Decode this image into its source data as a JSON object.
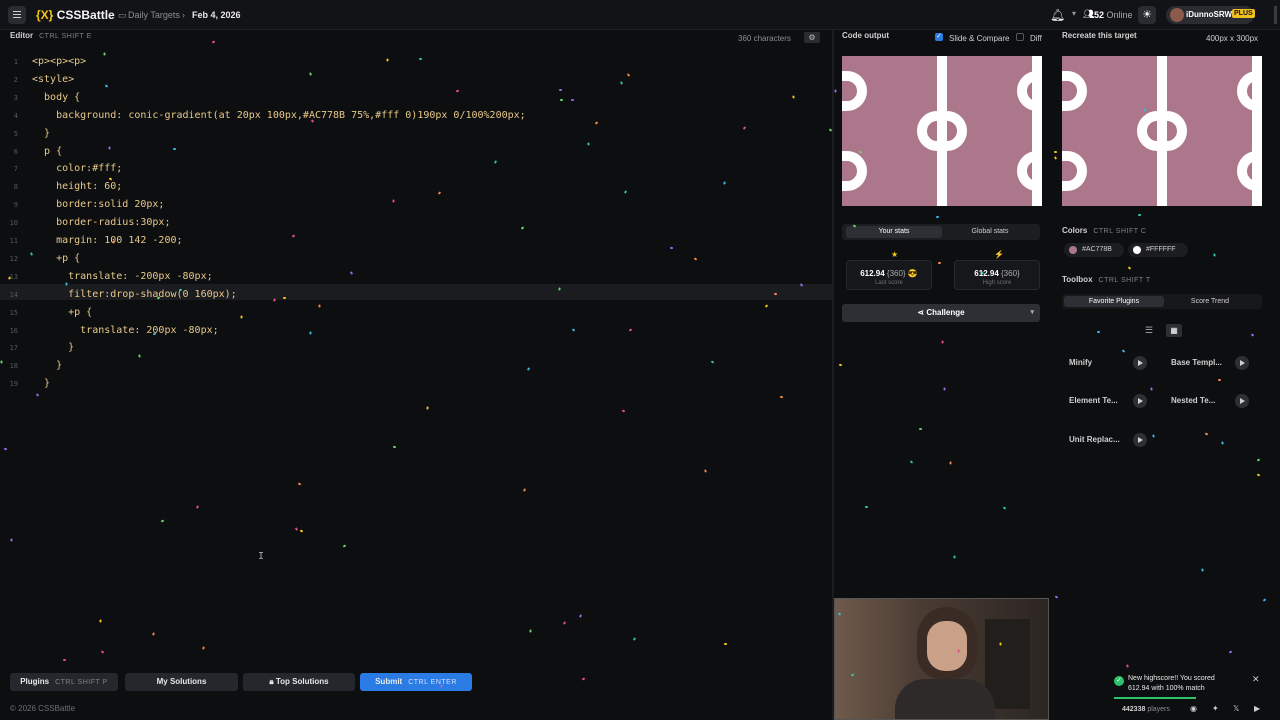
{
  "topbar": {
    "logo_brand": "{X}",
    "logo_text": "CSSBattle",
    "crumb_daily": "Daily Targets",
    "crumb_date": "Feb 4, 2026",
    "online_count": "52",
    "online_label": "Online",
    "username": "iDunnoSRW",
    "plus_label": "PLUS"
  },
  "editor": {
    "title": "Editor",
    "shortcut": "CTRL SHIFT E",
    "char_count": "360 characters",
    "lines": [
      "<p><p><p>",
      "<style>",
      "  body {",
      "    background: conic-gradient(at 20px 100px,#AC778B 75%,#fff 0)190px 0/100%200px;",
      "  }",
      "  p {",
      "    color:#fff;",
      "    height: 60;",
      "    border:solid 20px;",
      "    border-radius:30px;",
      "    margin: 100 142 -200;",
      "    +p {",
      "      translate: -200px -80px;",
      "      filter:drop-shadow(0 160px);",
      "      +p {",
      "        translate: 200px -80px;",
      "      }",
      "    }",
      "  }"
    ]
  },
  "output": {
    "title": "Code output",
    "slide_compare": "Slide & Compare",
    "diff": "Diff",
    "target_title": "Recreate this target",
    "target_size": "400px x 300px"
  },
  "stats": {
    "tab_yours": "Your stats",
    "tab_global": "Global stats",
    "last_score": "612.94",
    "last_chars": "{360}",
    "last_label": "Last score",
    "high_score": "612.94",
    "high_chars": "{360}",
    "high_label": "High score",
    "challenge": "Challenge"
  },
  "colors": {
    "title": "Colors",
    "shortcut": "CTRL SHIFT C",
    "swatches": [
      {
        "hex": "#AC778B"
      },
      {
        "hex": "#FFFFFF"
      }
    ]
  },
  "toolbox": {
    "title": "Toolbox",
    "shortcut": "CTRL SHIFT T",
    "tab_favorites": "Favorite Plugins",
    "tab_trend": "Score Trend",
    "plugins": [
      "Minify",
      "Base Templ...",
      "Element Te...",
      "Nested Te...",
      "Unit Replac..."
    ]
  },
  "bottom": {
    "plugins": "Plugins",
    "plugins_shortcut": "CTRL SHIFT P",
    "my_solutions": "My Solutions",
    "top_solutions": "Top Solutions",
    "submit": "Submit",
    "submit_shortcut": "CTRL ENTER",
    "copyright": "© 2026 CSSBattle"
  },
  "toast": {
    "line1": "New highscore!! You scored",
    "line2": "612.94 with 100% match"
  },
  "footer": {
    "players": "442338",
    "players_label": "players"
  },
  "accent": "#2a7be4",
  "target_color": "#AC778B"
}
